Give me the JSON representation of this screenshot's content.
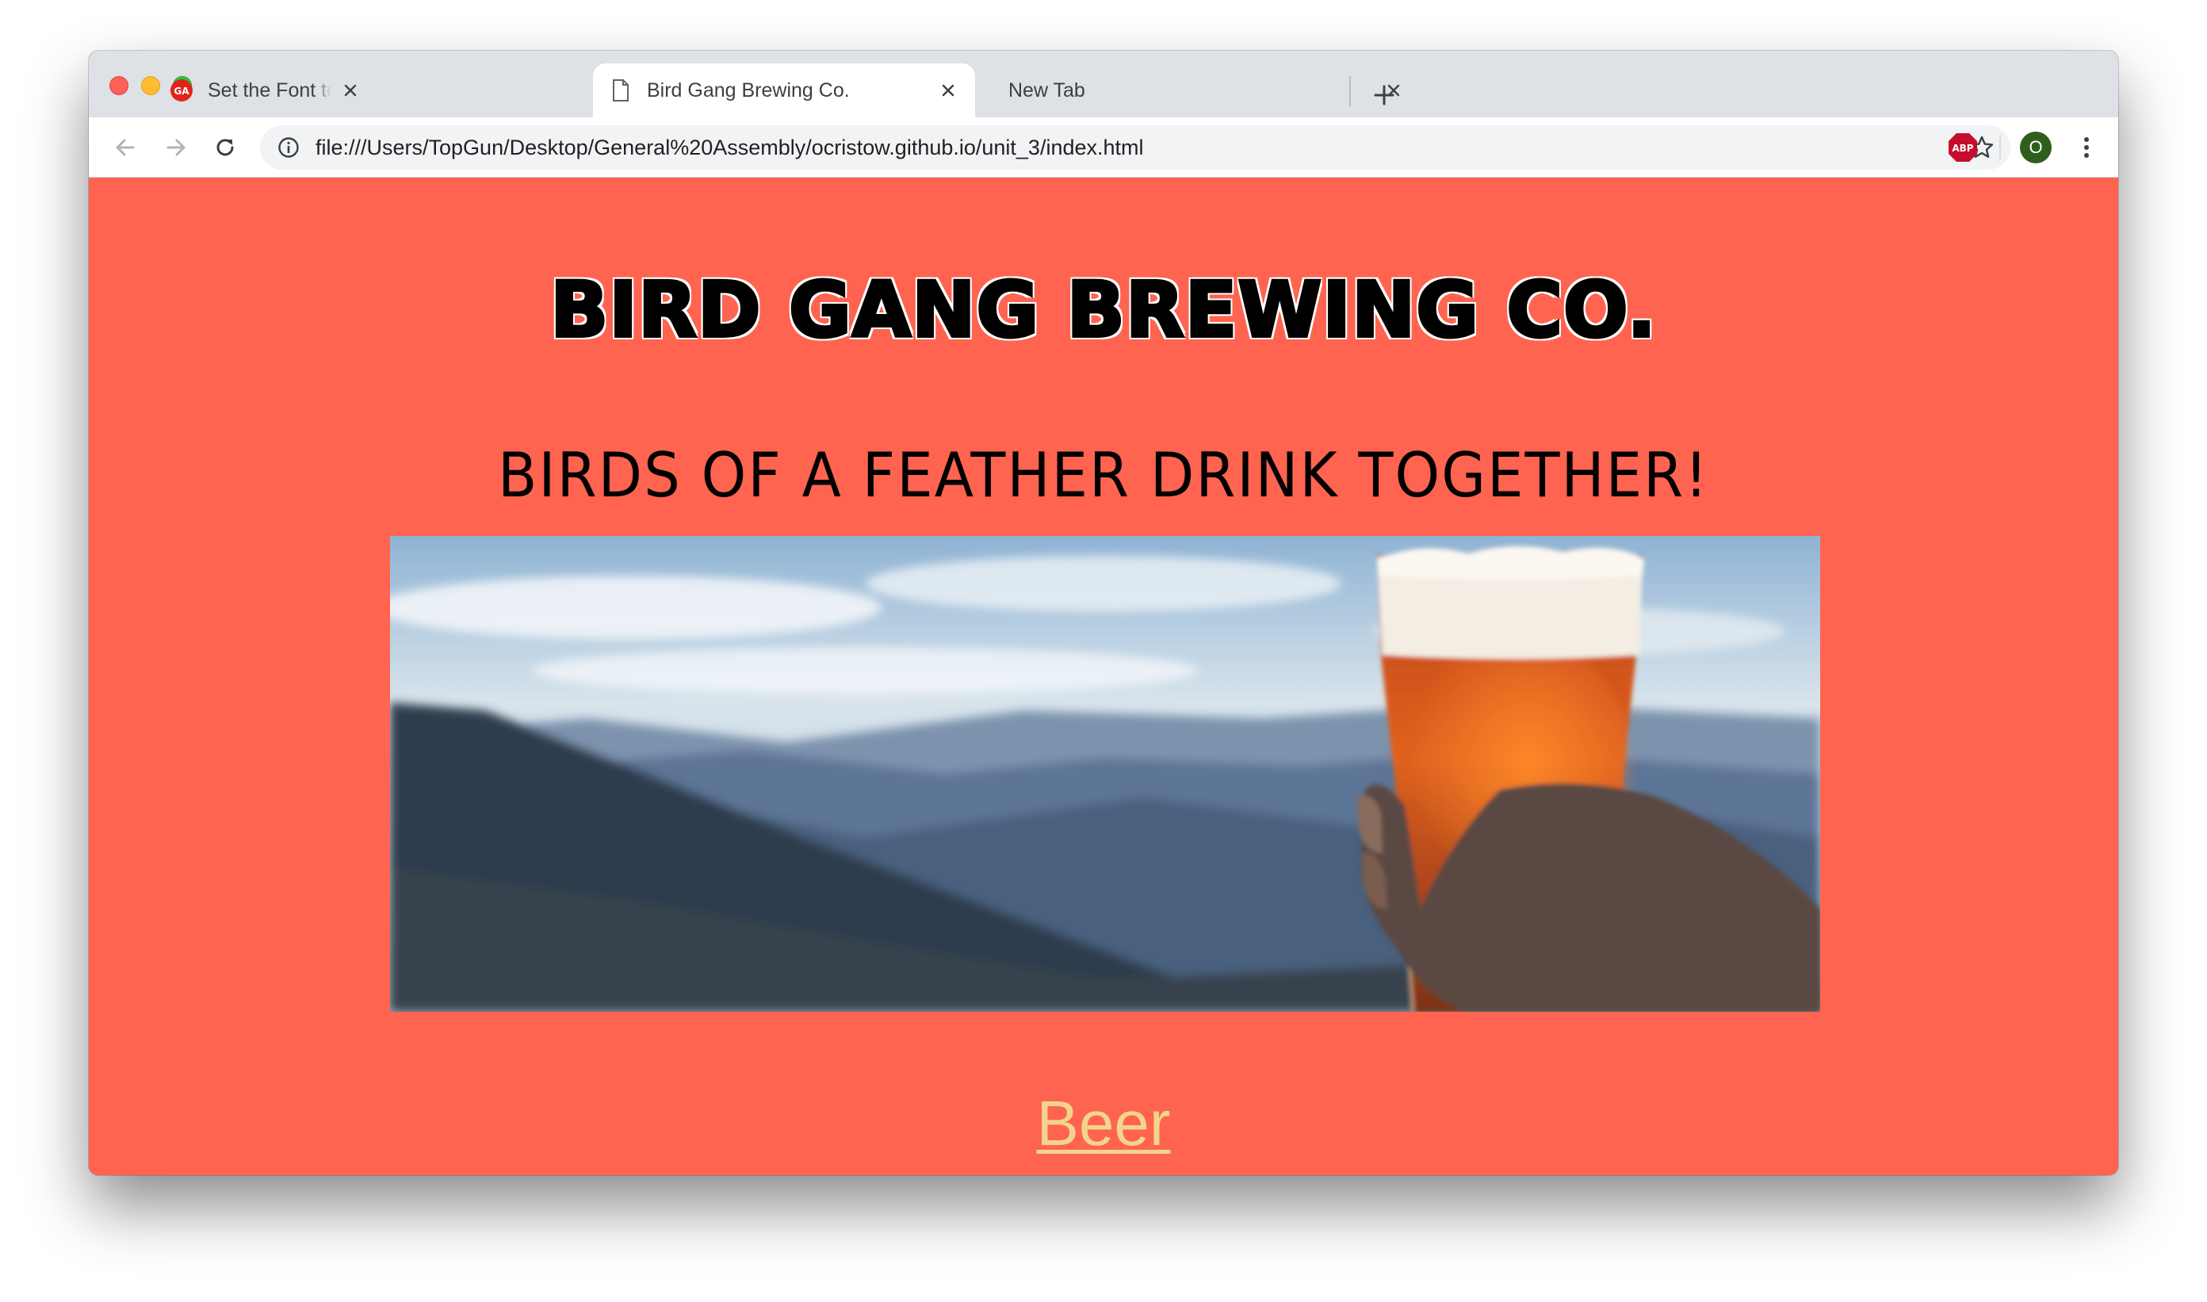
{
  "browser": {
    "tabs": [
      {
        "title": "Set the Font to Set the | HTML",
        "favicon": "ga-logo-icon",
        "active": false
      },
      {
        "title": "Bird Gang Brewing Co.",
        "favicon": "document-icon",
        "active": true
      },
      {
        "title": "New Tab",
        "favicon": "",
        "active": false
      }
    ],
    "url": "file:///Users/TopGun/Desktop/General%20Assembly/ocristow.github.io/unit_3/index.html",
    "profile_initial": "O",
    "extension_label": "ABP"
  },
  "page": {
    "site_title": "Bird Gang Brewing Co.",
    "tagline": "Birds of a Feather Drink Together!",
    "nav_link": "Beer",
    "hero_image": "mountain-landscape-with-raised-beer-glass"
  },
  "colors": {
    "page_background": "#ff6450",
    "link": "#f1d58b",
    "tab_strip": "#dee1e6"
  }
}
